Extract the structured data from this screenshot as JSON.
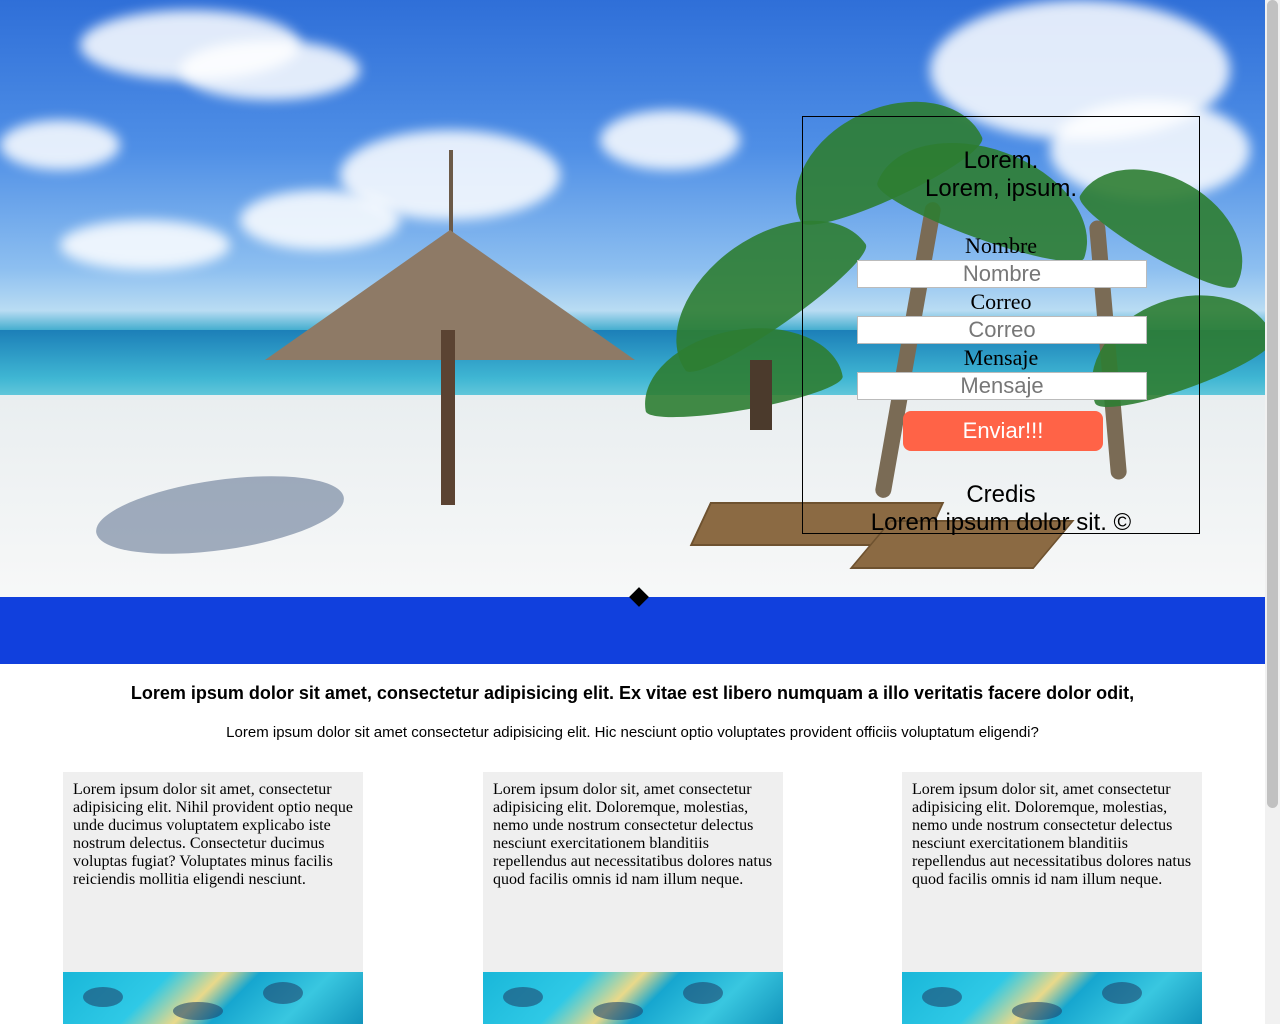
{
  "hero": {
    "panel": {
      "title_line1": "Lorem.",
      "title_line2": "Lorem, ipsum.",
      "name_label": "Nombre",
      "name_placeholder": "Nombre",
      "email_label": "Correo",
      "email_placeholder": "Correo",
      "message_label": "Mensaje",
      "message_placeholder": "Mensaje",
      "submit_label": "Enviar!!!",
      "credits_title": "Credis",
      "credits_text": "Lorem ipsum dolor sit. ©"
    }
  },
  "main": {
    "headline": "Lorem ipsum dolor sit amet, consectetur adipisicing elit. Ex vitae est libero numquam a illo veritatis facere dolor odit,",
    "subline": "Lorem ipsum dolor sit amet consectetur adipisicing elit. Hic nesciunt optio voluptates provident officiis voluptatum eligendi?",
    "cards": [
      {
        "text": "Lorem ipsum dolor sit amet, consectetur adipisicing elit. Nihil provident optio neque unde ducimus voluptatem explicabo iste nostrum delectus. Consectetur ducimus voluptas fugiat? Voluptates minus facilis reiciendis mollitia eligendi nesciunt."
      },
      {
        "text": "Lorem ipsum dolor sit, amet consectetur adipisicing elit. Doloremque, molestias, nemo unde nostrum consectetur delectus nesciunt exercitationem blanditiis repellendus aut necessitatibus dolores natus quod facilis omnis id nam illum neque."
      },
      {
        "text": "Lorem ipsum dolor sit, amet consectetur adipisicing elit. Doloremque, molestias, nemo unde nostrum consectetur delectus nesciunt exercitationem blanditiis repellendus aut necessitatibus dolores natus quod facilis omnis id nam illum neque."
      }
    ]
  },
  "colors": {
    "band": "#1140dd",
    "button": "#ff6347",
    "card_bg": "#efefef"
  }
}
